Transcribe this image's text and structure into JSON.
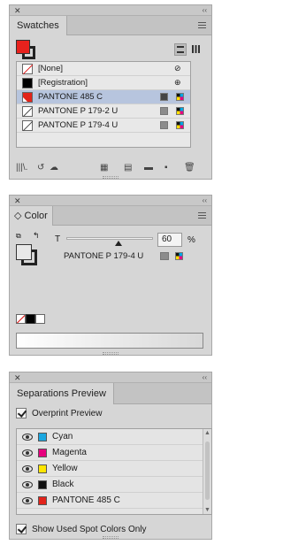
{
  "swatches_panel": {
    "tab_label": "Swatches",
    "fill_color": "#e8221d",
    "rows": [
      {
        "label": "[None]",
        "chip": "none"
      },
      {
        "label": "[Registration]",
        "chip": "black"
      },
      {
        "label": "PANTONE 485 C",
        "chip": "red",
        "selected": true
      },
      {
        "label": "PANTONE P 179-2 U",
        "chip": "diag"
      },
      {
        "label": "PANTONE P 179-4 U",
        "chip": "diag"
      }
    ],
    "bottom_icons": [
      "library-icon",
      "cloud-sync-icon",
      "creative-cloud-icon",
      "show-kinds-icon",
      "new-group-icon",
      "folder-icon",
      "new-swatch-icon",
      "trash-icon"
    ]
  },
  "color_panel": {
    "tab_label": "◇ Color",
    "tint_label": "T",
    "tint_value": "60",
    "tint_unit": "%",
    "swatch_name": "PANTONE P 179-4 U",
    "tint_fraction": 0.6
  },
  "separations_panel": {
    "tab_label": "Separations Preview",
    "overprint_label": "Overprint Preview",
    "inks": [
      {
        "name": "Cyan",
        "color": "#1aa7e0"
      },
      {
        "name": "Magenta",
        "color": "#e6007e"
      },
      {
        "name": "Yellow",
        "color": "#ffe600"
      },
      {
        "name": "Black",
        "color": "#111111"
      },
      {
        "name": "PANTONE 485 C",
        "color": "#e2231a"
      }
    ],
    "spot_label": "Show Used Spot Colors Only"
  }
}
